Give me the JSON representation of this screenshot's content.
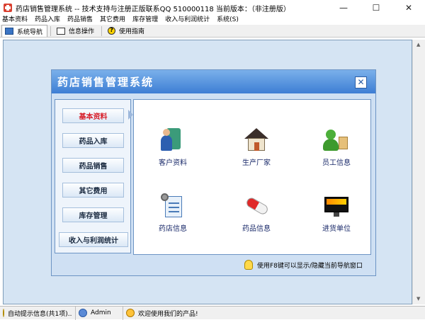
{
  "window": {
    "title": "药店销售管理系统 -- 技术支持与注册正版联系QQ 510000118    当前版本：（非注册版）",
    "min": "—",
    "max": "☐",
    "close": "✕"
  },
  "menu": [
    "基本资料",
    "药品入库",
    "药品销售",
    "其它费用",
    "库存管理",
    "收入与利润统计",
    "系统(S)"
  ],
  "tabs": [
    "系统导航",
    "信息操作",
    "使用指南"
  ],
  "nav": {
    "title": "药店销售管理系统",
    "close": "✕",
    "left_buttons": [
      "基本资料",
      "药品入库",
      "药品销售",
      "其它费用",
      "库存管理",
      "收入与利润统计"
    ],
    "active_index": 0,
    "items": [
      "客户资料",
      "生产厂家",
      "员工信息",
      "药店信息",
      "药品信息",
      "进货单位"
    ],
    "hint": "使用F8键可以显示/隐藏当前导航窗口"
  },
  "status": {
    "tips": "自动提示信息(共1项)..",
    "user": "Admin",
    "welcome": "欢迎使用我们的产品!"
  },
  "colors": {
    "header_top": "#7ab0ea",
    "header_bottom": "#3d7ed4",
    "workspace": "#d5e4f3",
    "active_text": "#d8202a"
  },
  "icons": {
    "app": "app-cross-icon",
    "items": [
      "client-icon",
      "factory-house-icon",
      "staff-icon",
      "store-doc-icon",
      "pill-icon",
      "supplier-screen-icon"
    ]
  }
}
